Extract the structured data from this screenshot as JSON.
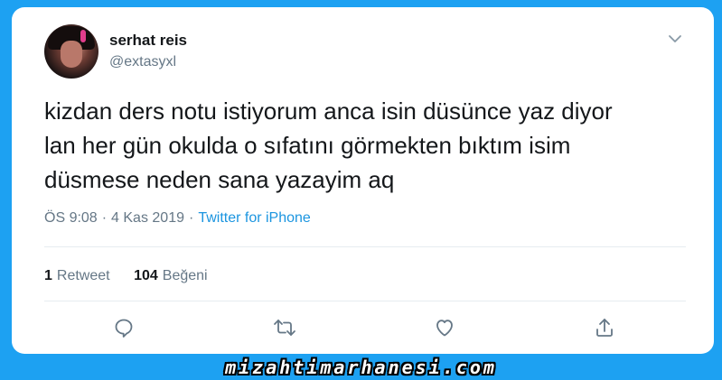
{
  "user": {
    "name": "serhat reis",
    "handle": "@extasyxl"
  },
  "tweet": {
    "text": "kizdan ders notu istiyorum anca isin düsünce yaz diyor\nlan her gün okulda o sıfatını görmekten bıktım isim\ndüsmese neden sana yazayim aq",
    "time": "ÖS 9:08",
    "separator": "·",
    "date": "4 Kas 2019",
    "source": "Twitter for iPhone"
  },
  "stats": {
    "retweet_count": "1",
    "retweet_label": "Retweet",
    "like_count": "104",
    "like_label": "Beğeni"
  },
  "actions": [
    "reply-icon",
    "retweet-icon",
    "like-icon",
    "share-icon"
  ],
  "watermark": "mizahtimarhanesi.com",
  "colors": {
    "background": "#1da1f2",
    "text": "#14171a",
    "muted": "#657786",
    "link": "#1b95e0"
  }
}
